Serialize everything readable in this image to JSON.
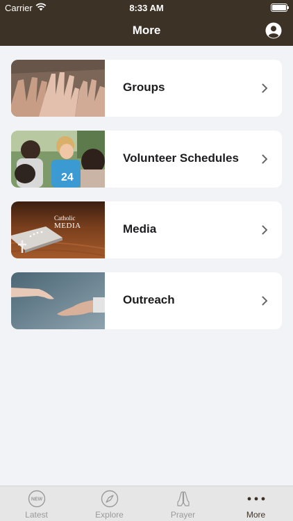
{
  "status_bar": {
    "carrier": "Carrier",
    "time": "8:33 AM"
  },
  "nav": {
    "title": "More"
  },
  "items": [
    {
      "label": "Groups",
      "image": "hands-photo"
    },
    {
      "label": "Volunteer Schedules",
      "image": "volunteers-photo"
    },
    {
      "label": "Media",
      "image": "bible-photo",
      "overlay_small": "Catholic",
      "overlay_big": "MEDIA"
    },
    {
      "label": "Outreach",
      "image": "reaching-hands-photo"
    }
  ],
  "tabs": [
    {
      "label": "Latest",
      "icon": "new-badge-icon",
      "badge": "NEW",
      "active": false
    },
    {
      "label": "Explore",
      "icon": "compass-icon",
      "active": false
    },
    {
      "label": "Prayer",
      "icon": "praying-hands-icon",
      "active": false
    },
    {
      "label": "More",
      "icon": "more-dots-icon",
      "active": true
    }
  ],
  "colors": {
    "header": "#3d3226",
    "background": "#f2f3f7",
    "tab_active": "#3d3226",
    "tab_inactive": "#9a9a9a"
  }
}
